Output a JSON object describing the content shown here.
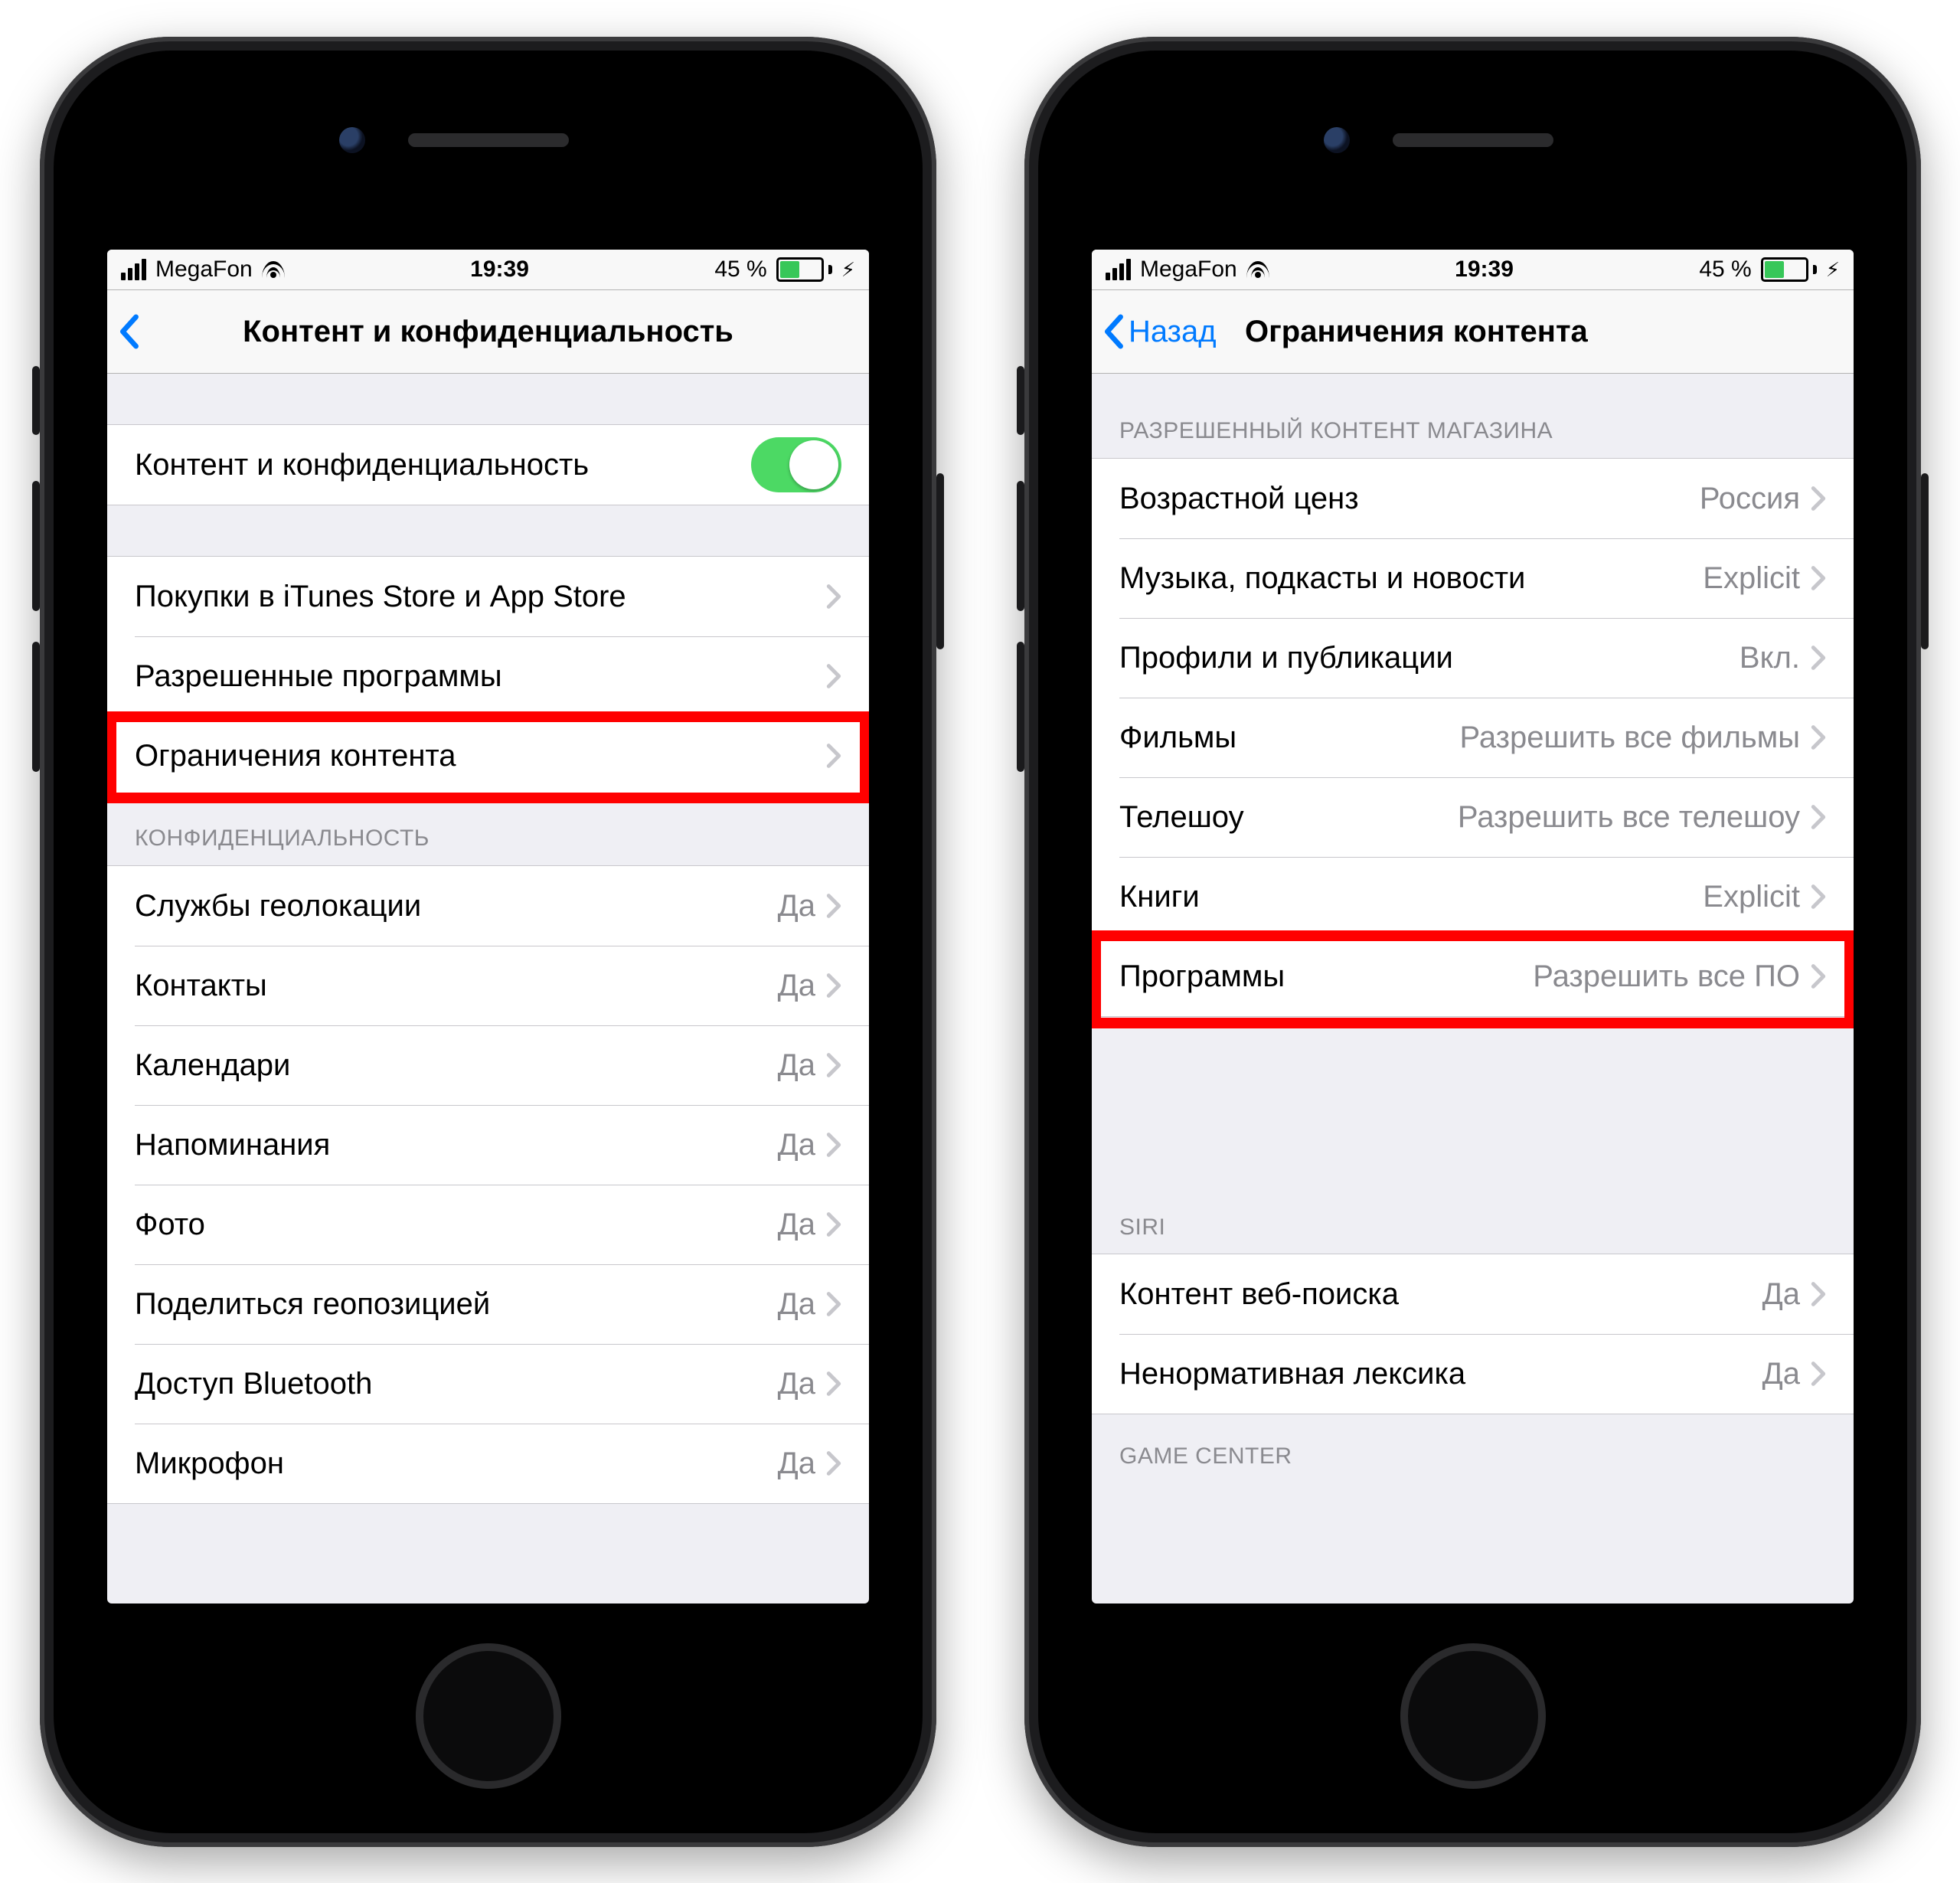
{
  "status": {
    "carrier": "MegaFon",
    "time": "19:39",
    "battery_pct": "45 %"
  },
  "left": {
    "nav": {
      "title": "Контент и конфиденциальность"
    },
    "toggle": {
      "label": "Контент и конфиденциальность"
    },
    "section1": {
      "items": [
        {
          "label": "Покупки в iTunes Store и App Store"
        },
        {
          "label": "Разрешенные программы"
        },
        {
          "label": "Ограничения контента"
        }
      ]
    },
    "privacy_header": "КОНФИДЕНЦИАЛЬНОСТЬ",
    "privacy": {
      "items": [
        {
          "label": "Службы геолокации",
          "value": "Да"
        },
        {
          "label": "Контакты",
          "value": "Да"
        },
        {
          "label": "Календари",
          "value": "Да"
        },
        {
          "label": "Напоминания",
          "value": "Да"
        },
        {
          "label": "Фото",
          "value": "Да"
        },
        {
          "label": "Поделиться геопозицией",
          "value": "Да"
        },
        {
          "label": "Доступ Bluetooth",
          "value": "Да"
        },
        {
          "label": "Микрофон",
          "value": "Да"
        }
      ]
    }
  },
  "right": {
    "nav": {
      "back": "Назад",
      "title": "Ограничения контента"
    },
    "store_header": "РАЗРЕШЕННЫЙ КОНТЕНТ МАГАЗИНА",
    "store": {
      "items": [
        {
          "label": "Возрастной ценз",
          "value": "Россия"
        },
        {
          "label": "Музыка, подкасты и новости",
          "value": "Explicit"
        },
        {
          "label": "Профили и публикации",
          "value": "Вкл."
        },
        {
          "label": "Фильмы",
          "value": "Разрешить все фильмы"
        },
        {
          "label": "Телешоу",
          "value": "Разрешить все телешоу"
        },
        {
          "label": "Книги",
          "value": "Explicit"
        },
        {
          "label": "Программы",
          "value": "Разрешить все ПО"
        }
      ]
    },
    "siri_header": "SIRI",
    "siri": {
      "items": [
        {
          "label": "Контент веб-поиска",
          "value": "Да"
        },
        {
          "label": "Ненормативная лексика",
          "value": "Да"
        }
      ]
    },
    "gc_header": "GAME CENTER"
  }
}
